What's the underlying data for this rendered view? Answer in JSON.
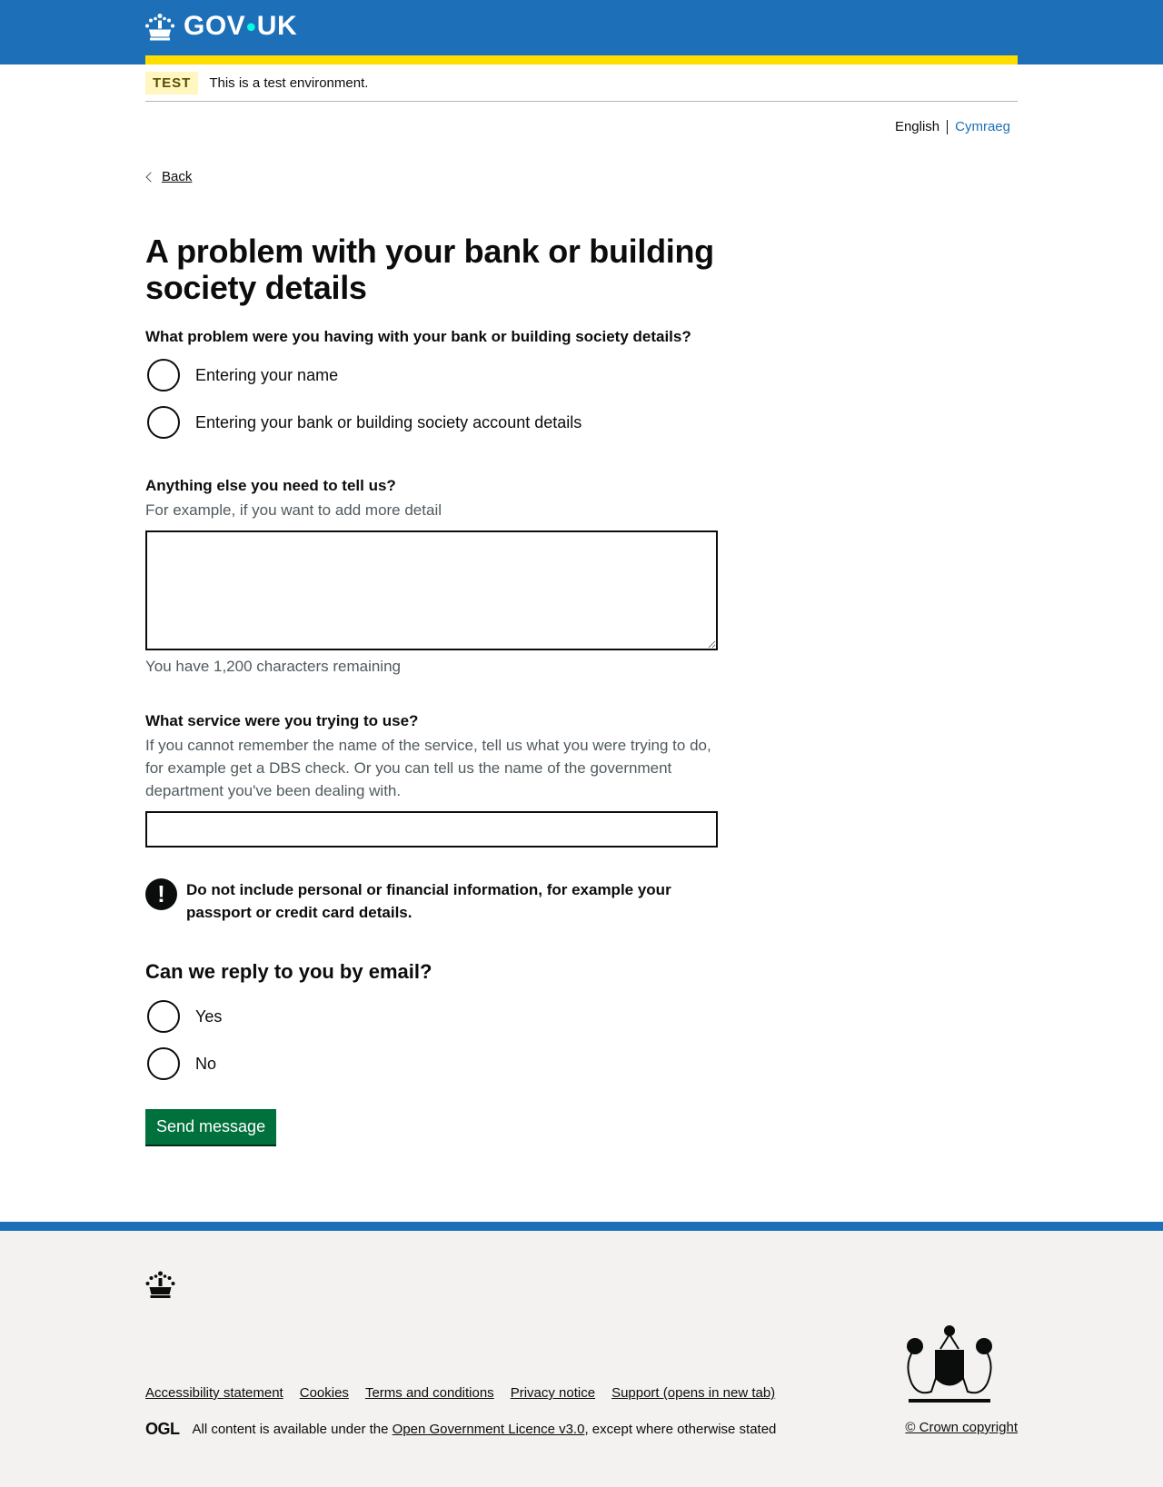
{
  "header": {
    "logo_text": "GOV",
    "logo_text2": "UK"
  },
  "phase": {
    "tag": "TEST",
    "text": "This is a test environment."
  },
  "language": {
    "current": "English",
    "other": "Cymraeg"
  },
  "back_link": "Back",
  "page_title": "A problem with your bank or building society details",
  "problem_question": {
    "legend": "What problem were you having with your bank or building society details?",
    "options": [
      "Entering your name",
      "Entering your bank or building society account details"
    ]
  },
  "more_detail": {
    "label": "Anything else you need to tell us?",
    "hint": "For example, if you want to add more detail",
    "value": "",
    "counter": "You have 1,200 characters remaining"
  },
  "service": {
    "label": "What service were you trying to use?",
    "hint": "If you cannot remember the name of the service, tell us what you were trying to do, for example get a DBS check. Or you can tell us the name of the government department you've been dealing with.",
    "value": ""
  },
  "warning": {
    "icon": "!",
    "text": "Do not include personal or financial information, for example your passport or credit card details."
  },
  "reply": {
    "heading": "Can we reply to you by email?",
    "options": [
      "Yes",
      "No"
    ]
  },
  "submit_label": "Send message",
  "footer": {
    "links": [
      "Accessibility statement",
      "Cookies",
      "Terms and conditions",
      "Privacy notice",
      "Support (opens in new tab)"
    ],
    "ogl_logo": "OGL",
    "licence_prefix": "All content is available under the",
    "licence_link": "Open Government Licence v3.0",
    "licence_suffix": ", except where otherwise stated",
    "copyright": "© Crown copyright"
  },
  "colors": {
    "header_blue": "#1d70b8",
    "header_bar_yellow": "#ffdd00",
    "button_green": "#00703c"
  }
}
